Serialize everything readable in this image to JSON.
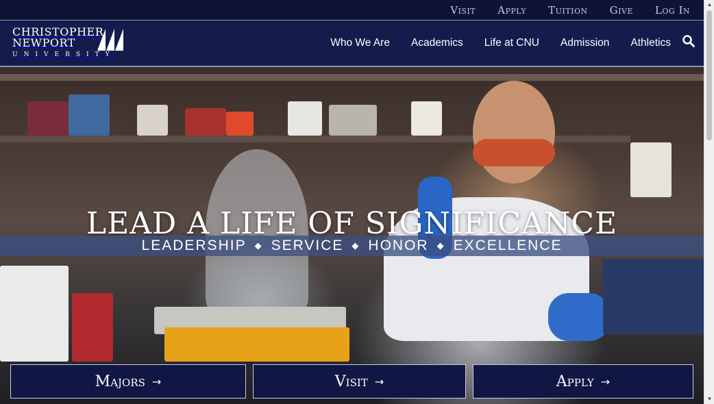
{
  "utility_nav": [
    "Visit",
    "Apply",
    "Tuition",
    "Give",
    "Log In"
  ],
  "logo": {
    "line1": "CHRISTOPHER",
    "line2": "NEWPORT",
    "line3": "UNIVERSITY"
  },
  "main_nav": [
    "Who We Are",
    "Academics",
    "Life at CNU",
    "Admission",
    "Athletics"
  ],
  "search_icon": "search-icon",
  "hero": {
    "title": "LEAD A LIFE OF SIGNIFICANCE",
    "values": [
      "LEADERSHIP",
      "SERVICE",
      "HONOR",
      "EXCELLENCE"
    ],
    "separator": "◆"
  },
  "cta": [
    {
      "label": "Majors",
      "arrow": "→"
    },
    {
      "label": "Visit",
      "arrow": "→"
    },
    {
      "label": "Apply",
      "arrow": "→"
    }
  ],
  "colors": {
    "navy": "#141c4c",
    "utility_bg": "#0d1436",
    "band": "#3c5082",
    "white": "#ffffff"
  }
}
